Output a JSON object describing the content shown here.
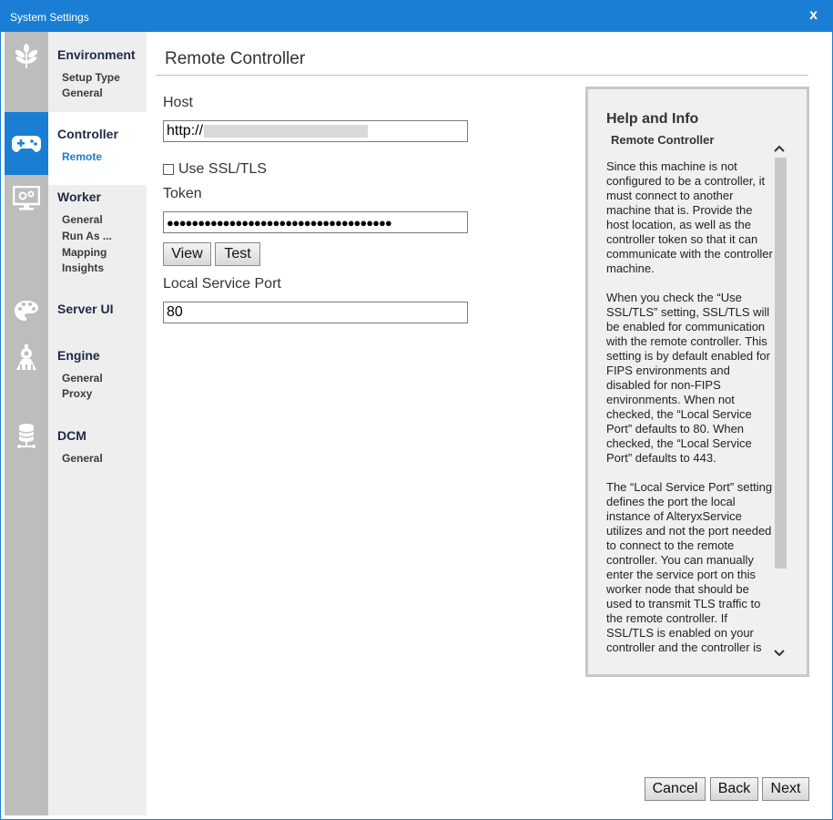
{
  "window": {
    "title": "System Settings",
    "close_glyph": "x",
    "accent": "#1a7fd4"
  },
  "iconbar": [
    {
      "icon": "environment-leaf-icon"
    },
    {
      "icon": "gamepad-icon"
    },
    {
      "icon": "monitor-gear-icon"
    },
    {
      "icon": "palette-icon"
    },
    {
      "icon": "engine-icon"
    },
    {
      "icon": "database-icon"
    }
  ],
  "nav": {
    "environment": {
      "label": "Environment",
      "items": [
        "Setup Type",
        "General"
      ]
    },
    "controller": {
      "label": "Controller",
      "items": [
        "Remote"
      ]
    },
    "worker": {
      "label": "Worker",
      "items": [
        "General",
        "Run As ...",
        "Mapping",
        "Insights"
      ]
    },
    "server_ui": {
      "label": "Server UI"
    },
    "engine": {
      "label": "Engine",
      "items": [
        "General",
        "Proxy"
      ]
    },
    "dcm": {
      "label": "DCM",
      "items": [
        "General"
      ]
    }
  },
  "main": {
    "title": "Remote Controller",
    "host_label": "Host",
    "host_value": "http://",
    "ssl_label": "Use SSL/TLS",
    "ssl_checked": false,
    "token_label": "Token",
    "token_value": "●●●●●●●●●●●●●●●●●●●●●●●●●●●●●●●●●●●●",
    "view_label": "View",
    "test_label": "Test",
    "port_label": "Local Service Port",
    "port_value": "80"
  },
  "help": {
    "title": "Help and Info",
    "subtitle": "Remote Controller",
    "paragraphs": [
      "Since this machine is not configured to be a controller, it must connect to another machine that is. Provide the host location, as well as the controller token so that it can communicate with the controller machine.",
      "When you check the “Use SSL/TLS” setting, SSL/TLS will be enabled for communication with the remote controller. This setting is by default enabled for FIPS environments and disabled for non-FIPS environments. When not checked, the “Local Service Port” defaults to 80. When checked, the “Local Service Port” defaults to 443.",
      "The “Local Service Port” setting defines the port the local instance of AlteryxService utilizes and not the port needed to connect to the remote controller. You can manually enter the service port on this worker node that should be used to transmit TLS traffic to the remote controller. If SSL/TLS is enabled on your controller and the controller is"
    ]
  },
  "footer": {
    "cancel": "Cancel",
    "back": "Back",
    "next": "Next"
  }
}
